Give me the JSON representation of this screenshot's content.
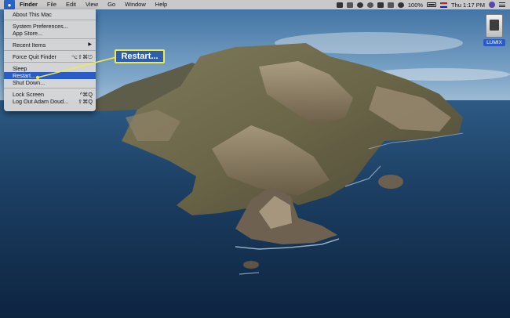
{
  "menubar": {
    "apple_icon": "apple-logo-icon",
    "app_name": "Finder",
    "menus": [
      "File",
      "Edit",
      "View",
      "Go",
      "Window",
      "Help"
    ],
    "status": {
      "battery_percent": "100%",
      "clock": "Thu 1:17 PM"
    }
  },
  "apple_menu": {
    "items": [
      {
        "label": "About This Mac",
        "shortcut": ""
      },
      {
        "label": "System Preferences...",
        "shortcut": ""
      },
      {
        "label": "App Store...",
        "shortcut": ""
      },
      {
        "label": "Recent Items",
        "shortcut": "",
        "submenu": true
      },
      {
        "label": "Force Quit Finder",
        "shortcut": "⌥⇧⌘⎋"
      },
      {
        "label": "Sleep",
        "shortcut": ""
      },
      {
        "label": "Restart...",
        "shortcut": "",
        "highlighted": true
      },
      {
        "label": "Shut Down...",
        "shortcut": ""
      },
      {
        "label": "Lock Screen",
        "shortcut": "^⌘Q"
      },
      {
        "label": "Log Out Adam Doud...",
        "shortcut": "⇧⌘Q"
      }
    ]
  },
  "callout": {
    "label": "Restart..."
  },
  "desktop": {
    "drive_label": "LUMIX"
  },
  "colors": {
    "menu_highlight": "#2a5cc7",
    "callout_bg": "#2d5fae",
    "callout_border": "#f3e84a"
  }
}
